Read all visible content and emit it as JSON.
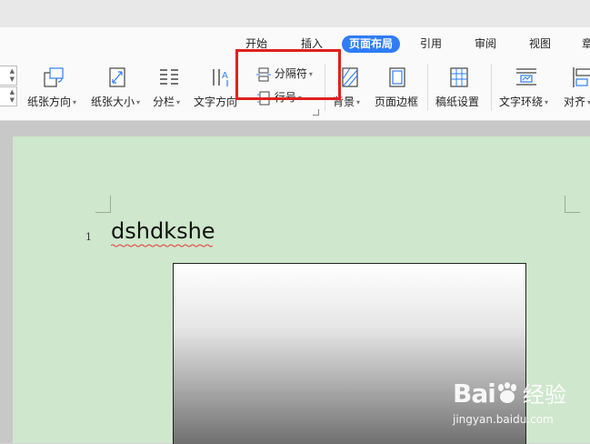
{
  "tabs": [
    {
      "label": "开始",
      "active": false
    },
    {
      "label": "插入",
      "active": false
    },
    {
      "label": "页面布局",
      "active": true
    },
    {
      "label": "引用",
      "active": false
    },
    {
      "label": "审阅",
      "active": false
    },
    {
      "label": "视图",
      "active": false
    },
    {
      "label": "章",
      "active": false
    }
  ],
  "ribbon": {
    "orientation": "纸张方向",
    "size": "纸张大小",
    "columns": "分栏",
    "text_direction": "文字方向",
    "breaks": "分隔符",
    "line_numbers": "行号",
    "background": "背景",
    "page_border": "页面边框",
    "paper_setup": "稿纸设置",
    "text_wrap": "文字环绕",
    "align": "对齐"
  },
  "document": {
    "line_number": "1",
    "text": "dshdkshe"
  },
  "watermark": {
    "brand": "Bai",
    "brand_suffix": "经验",
    "url": "jingyan.baidu.com"
  },
  "colors": {
    "accent": "#2f7cf5",
    "page_background": "#cfe7cc",
    "highlight": "#e02020"
  }
}
